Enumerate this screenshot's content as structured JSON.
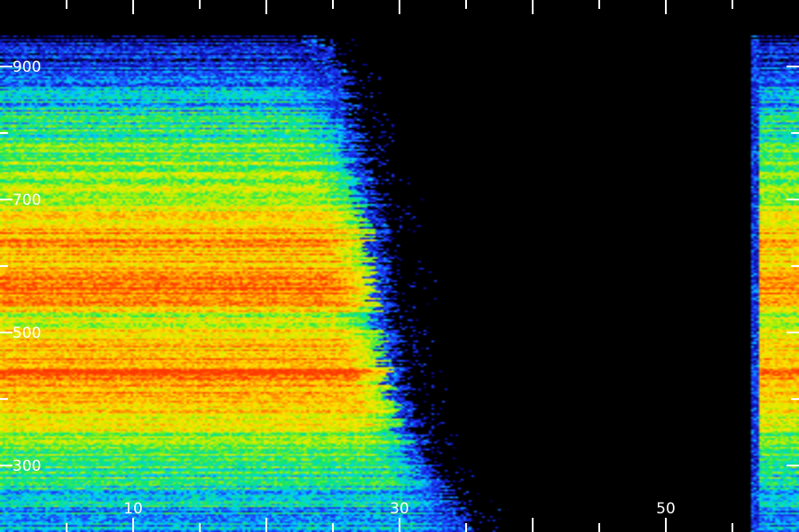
{
  "chart_data": {
    "type": "heatmap",
    "title": "",
    "xlabel": "",
    "ylabel": "",
    "xlim": [
      0,
      60
    ],
    "ylim": [
      200,
      1000
    ],
    "x_ticks": [
      10,
      30,
      50
    ],
    "y_ticks": [
      300,
      500,
      700,
      900
    ],
    "colormap": [
      "#000000",
      "#0a0aa0",
      "#1e3cff",
      "#00d2ff",
      "#10e860",
      "#b4f000",
      "#ffe600",
      "#ff9a00",
      "#ff3a00"
    ],
    "background": "#000000",
    "axis_color": "#ffffff",
    "grid": false,
    "intensity_profile_by_y": [
      {
        "y": 225,
        "level": 0.35
      },
      {
        "y": 270,
        "level": 0.45
      },
      {
        "y": 300,
        "level": 0.5
      },
      {
        "y": 340,
        "level": 0.6
      },
      {
        "y": 380,
        "level": 0.8
      },
      {
        "y": 410,
        "level": 0.85
      },
      {
        "y": 440,
        "level": 0.95
      },
      {
        "y": 480,
        "level": 0.8
      },
      {
        "y": 520,
        "level": 0.65
      },
      {
        "y": 560,
        "level": 0.95
      },
      {
        "y": 600,
        "level": 0.8
      },
      {
        "y": 640,
        "level": 0.85
      },
      {
        "y": 700,
        "level": 0.65
      },
      {
        "y": 760,
        "level": 0.55
      },
      {
        "y": 820,
        "level": 0.45
      },
      {
        "y": 880,
        "level": 0.3
      },
      {
        "y": 930,
        "level": 0.12
      }
    ],
    "main_band": {
      "x_start": 0,
      "edge_x_by_y": [
        {
          "y": 200,
          "x": 36
        },
        {
          "y": 240,
          "x": 34
        },
        {
          "y": 280,
          "x": 33
        },
        {
          "y": 320,
          "x": 32
        },
        {
          "y": 360,
          "x": 31
        },
        {
          "y": 400,
          "x": 30.5
        },
        {
          "y": 460,
          "x": 30
        },
        {
          "y": 520,
          "x": 29.5
        },
        {
          "y": 600,
          "x": 29
        },
        {
          "y": 680,
          "x": 28.5
        },
        {
          "y": 760,
          "x": 27.5
        },
        {
          "y": 820,
          "x": 26.5
        },
        {
          "y": 880,
          "x": 26
        },
        {
          "y": 950,
          "x": 24
        }
      ]
    },
    "right_band": {
      "x_start": 56.5,
      "x_end": 60,
      "y_range": [
        200,
        950
      ]
    }
  }
}
